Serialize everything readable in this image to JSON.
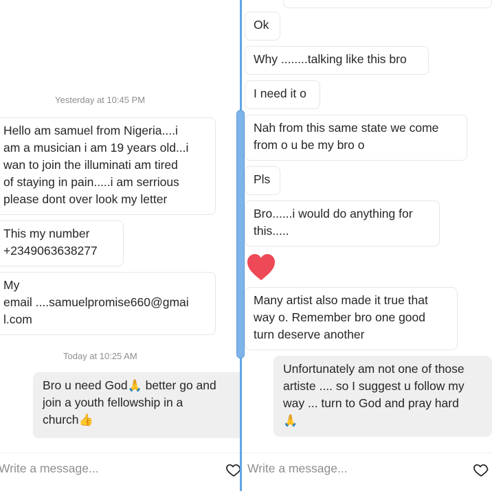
{
  "left": {
    "timestamp_yesterday": "Yesterday at 10:45 PM",
    "timestamp_today": "Today at 10:25 AM",
    "messages": [
      {
        "lines": [
          "Hello am samuel from Nigeria....i",
          "am a musician i am 19 years old...i",
          "wan to join the illuminati am tired",
          "of staying in pain.....i am serrious",
          "please dont over look my letter"
        ]
      },
      {
        "lines": [
          "This my number",
          "+2349063638277"
        ]
      },
      {
        "lines": [
          "My",
          "email ....samuelpromise660@gmai",
          "l.com"
        ]
      }
    ],
    "outgoing": {
      "line1_text": "Bro u need God",
      "line1_emoji": "🙏",
      "line1_tail": "  better go and",
      "line2": "join a youth fellowship in a",
      "line3_text": "church",
      "line3_emoji": "👍"
    },
    "composer_placeholder": "Write a message..."
  },
  "right": {
    "messages": [
      {
        "lines": [
          "Ok"
        ]
      },
      {
        "lines": [
          "Why ........talking like this bro"
        ]
      },
      {
        "lines": [
          "I need it o"
        ]
      },
      {
        "lines": [
          "Nah from this same state we come",
          "from o u be my bro o"
        ]
      },
      {
        "lines": [
          "Pls"
        ]
      },
      {
        "lines": [
          "Bro......i would do anything for",
          "this....."
        ]
      },
      {
        "lines": [
          "Many artist also made it true that",
          "way o.   Remember bro one good",
          "turn deserve another"
        ]
      }
    ],
    "outgoing": {
      "lines": [
        "Unfortunately am not one of those",
        "artiste .... so I suggest u follow my",
        "way ... turn to God and pray hard"
      ],
      "emoji": "🙏"
    },
    "composer_placeholder": "Write a message..."
  },
  "icons": {
    "heart_reaction": "heart-icon",
    "composer_like": "heart-outline-icon",
    "reaction_color": "#ed4956",
    "divider_color": "#5ea6e6"
  }
}
